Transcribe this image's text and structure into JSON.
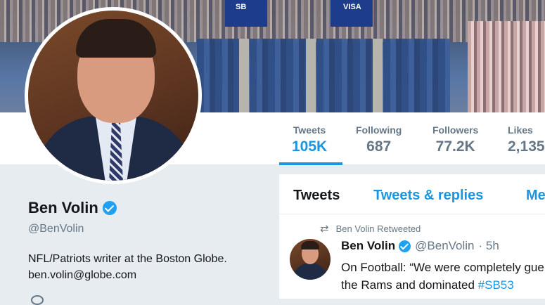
{
  "banner": {
    "sign_left": "SB",
    "sign_right": "VISA"
  },
  "stats": [
    {
      "label": "Tweets",
      "value": "105K",
      "active": true
    },
    {
      "label": "Following",
      "value": "687"
    },
    {
      "label": "Followers",
      "value": "77.2K"
    },
    {
      "label": "Likes",
      "value": "2,135"
    }
  ],
  "profile": {
    "name": "Ben Volin",
    "handle": "@BenVolin",
    "bio_line1": "NFL/Patriots writer at the Boston Globe.",
    "bio_line2": "ben.volin@globe.com"
  },
  "tabs": [
    {
      "label": "Tweets"
    },
    {
      "label": "Tweets & replies"
    },
    {
      "label": "Me"
    }
  ],
  "tweet": {
    "retweet_note": "Ben Volin Retweeted",
    "author": "Ben Volin",
    "handle": "@BenVolin",
    "time": "· 5h",
    "line1": "On Football: “We were completely gue",
    "line2_prefix": "the Rams and dominated ",
    "hashtag": "#SB53"
  },
  "colors": {
    "accent": "#1b95e0",
    "verified": "#1da1f2"
  }
}
